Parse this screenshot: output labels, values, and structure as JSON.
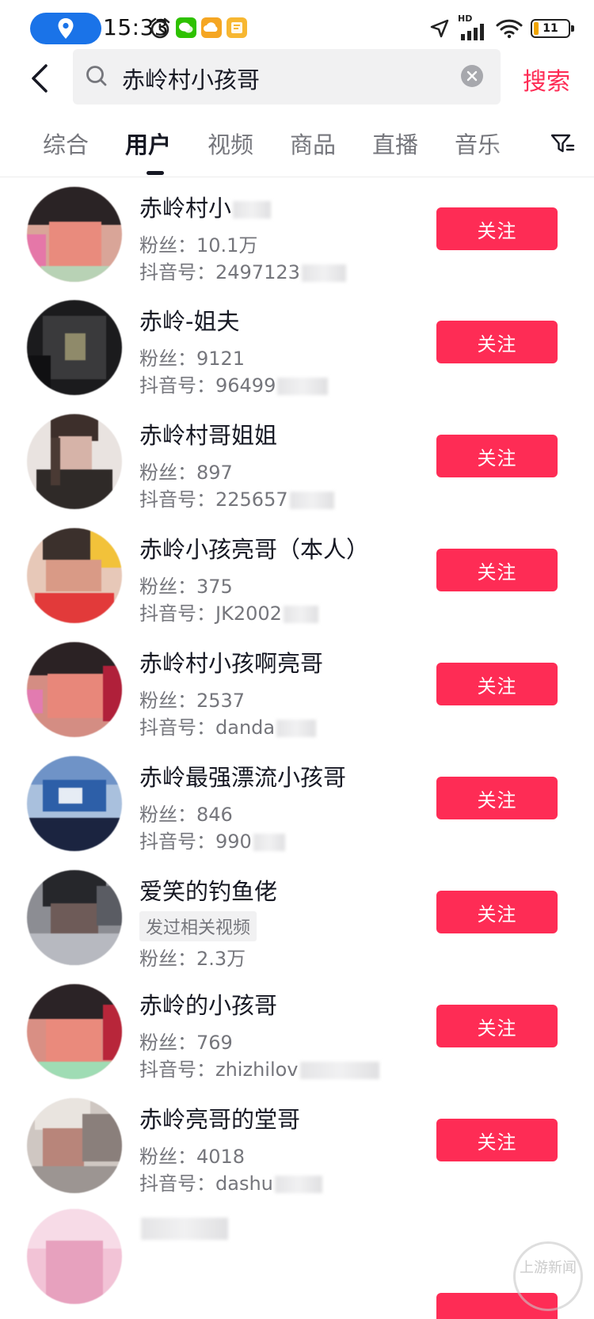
{
  "status_bar": {
    "time": "15:33",
    "network": "HD",
    "battery": "11"
  },
  "search": {
    "query": "赤岭村小孩哥",
    "action_label": "搜索"
  },
  "tabs": [
    {
      "label": "综合",
      "active": false
    },
    {
      "label": "用户",
      "active": true
    },
    {
      "label": "视频",
      "active": false
    },
    {
      "label": "商品",
      "active": false
    },
    {
      "label": "直播",
      "active": false
    },
    {
      "label": "音乐",
      "active": false
    }
  ],
  "users": [
    {
      "name": "赤岭村小",
      "fans": "粉丝：10.1万",
      "id": "抖音号：2497123",
      "follow": "关注"
    },
    {
      "name": "赤岭-姐夫",
      "fans": "粉丝：9121",
      "id": "抖音号：96499",
      "follow": "关注"
    },
    {
      "name": "赤岭村哥姐姐",
      "fans": "粉丝：897",
      "id": "抖音号：225657",
      "follow": "关注"
    },
    {
      "name": "赤岭小孩亮哥（本人）",
      "fans": "粉丝：375",
      "id": "抖音号：JK2002",
      "follow": "关注"
    },
    {
      "name": "赤岭村小孩啊亮哥",
      "fans": "粉丝：2537",
      "id": "抖音号：danda",
      "follow": "关注"
    },
    {
      "name": "赤岭最强漂流小孩哥",
      "fans": "粉丝：846",
      "id": "抖音号：990",
      "follow": "关注"
    },
    {
      "name": "爱笑的钓鱼佬",
      "tag": "发过相关视频",
      "fans": "粉丝：2.3万",
      "follow": "关注"
    },
    {
      "name": "赤岭的小孩哥",
      "fans": "粉丝：769",
      "id": "抖音号：zhizhilov",
      "follow": "关注"
    },
    {
      "name": "赤岭亮哥的堂哥",
      "fans": "粉丝：4018",
      "id": "抖音号：dashu",
      "follow": "关注"
    }
  ],
  "watermark": "上游新闻",
  "colors": {
    "accent": "#fe2c55",
    "text_primary": "#161823",
    "text_secondary": "#75767c"
  }
}
